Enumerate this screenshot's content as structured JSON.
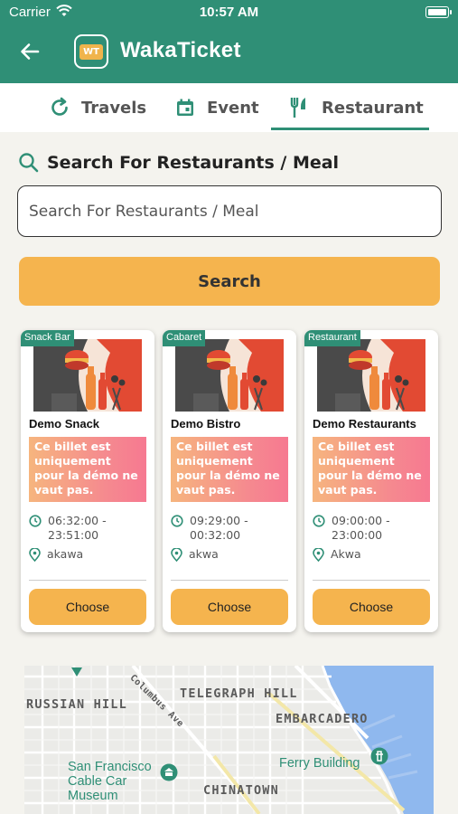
{
  "status_bar": {
    "carrier": "Carrier",
    "time": "10:57 AM"
  },
  "header": {
    "title": "WakaTicket",
    "logo_text": "WT"
  },
  "tabs": [
    {
      "label": "Travels",
      "icon": "refresh-icon",
      "active": false
    },
    {
      "label": "Event",
      "icon": "calendar-icon",
      "active": false
    },
    {
      "label": "Restaurant",
      "icon": "fork-knife-icon",
      "active": true
    }
  ],
  "search": {
    "heading": "Search For Restaurants / Meal",
    "placeholder": "Search For Restaurants / Meal",
    "value": "",
    "button_label": "Search"
  },
  "cards": [
    {
      "tag": "Snack Bar",
      "name": "Demo Snack",
      "promo": "Ce billet est uniquement pour la démo ne vaut pas.",
      "time": "06:32:00 - 23:51:00",
      "location": "akawa",
      "button_label": "Choose"
    },
    {
      "tag": "Cabaret",
      "name": "Demo Bistro",
      "promo": "Ce billet est uniquement pour la démo ne vaut pas.",
      "time": "09:29:00 - 00:32:00",
      "location": "akwa",
      "button_label": "Choose"
    },
    {
      "tag": "Restaurant",
      "name": "Demo Restaurants",
      "promo": "Ce billet est uniquement pour la démo ne vaut pas.",
      "time": "09:00:00 - 23:00:00",
      "location": "Akwa",
      "button_label": "Choose"
    }
  ],
  "map": {
    "labels": [
      "RUSSIAN HILL",
      "TELEGRAPH HILL",
      "EMBARCADERO",
      "CHINATOWN"
    ],
    "pois": [
      "San Francisco Cable Car Museum",
      "Ferry Building"
    ],
    "streets": [
      "Columbus Ave"
    ]
  },
  "colors": {
    "primary": "#2f8f76",
    "accent": "#f5b44e",
    "promo_gradient_end": "#f67991"
  }
}
